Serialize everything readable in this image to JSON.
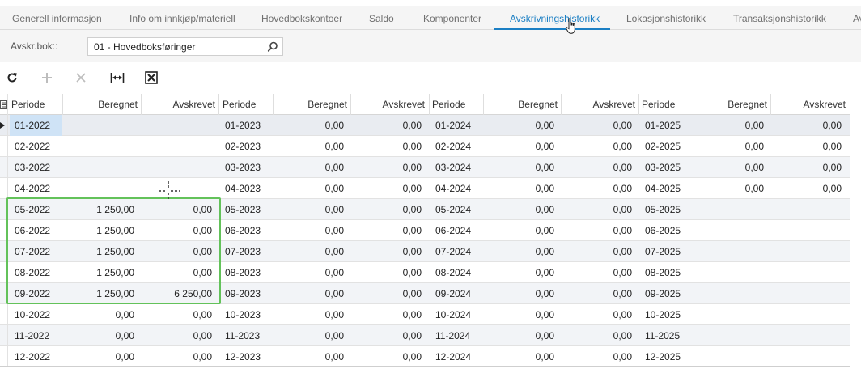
{
  "tabs": [
    {
      "label": "Generell informasjon",
      "active": false
    },
    {
      "label": "Info om innkjøp/materiell",
      "active": false
    },
    {
      "label": "Hovedbokskontoer",
      "active": false
    },
    {
      "label": "Saldo",
      "active": false
    },
    {
      "label": "Komponenter",
      "active": false
    },
    {
      "label": "Avskrivningshistorikk",
      "active": true
    },
    {
      "label": "Lokasjonshistorikk",
      "active": false
    },
    {
      "label": "Transaksjonshistorikk",
      "active": false
    },
    {
      "label": "Av",
      "active": false
    }
  ],
  "filter": {
    "label": "Avskr.bok::",
    "value": "01 - Hovedboksføringer"
  },
  "toolbar": {
    "icons": [
      "refresh-icon",
      "add-icon",
      "delete-icon",
      "fit-columns-icon",
      "export-excel-icon"
    ]
  },
  "grid": {
    "columns": [
      "Periode",
      "Beregnet",
      "Avskrevet",
      "Periode",
      "Beregnet",
      "Avskrevet",
      "Periode",
      "Beregnet",
      "Avskrevet",
      "Periode",
      "Beregnet",
      "Avskrevet"
    ],
    "rows": [
      [
        "01-2022",
        "",
        "",
        "01-2023",
        "0,00",
        "0,00",
        "01-2024",
        "0,00",
        "0,00",
        "01-2025",
        "0,00",
        "0,00"
      ],
      [
        "02-2022",
        "",
        "",
        "02-2023",
        "0,00",
        "0,00",
        "02-2024",
        "0,00",
        "0,00",
        "02-2025",
        "0,00",
        "0,00"
      ],
      [
        "03-2022",
        "",
        "",
        "03-2023",
        "0,00",
        "0,00",
        "03-2024",
        "0,00",
        "0,00",
        "03-2025",
        "0,00",
        "0,00"
      ],
      [
        "04-2022",
        "",
        "",
        "04-2023",
        "0,00",
        "0,00",
        "04-2024",
        "0,00",
        "0,00",
        "04-2025",
        "0,00",
        "0,00"
      ],
      [
        "05-2022",
        "1 250,00",
        "0,00",
        "05-2023",
        "0,00",
        "0,00",
        "05-2024",
        "0,00",
        "0,00",
        "05-2025",
        "",
        ""
      ],
      [
        "06-2022",
        "1 250,00",
        "0,00",
        "06-2023",
        "0,00",
        "0,00",
        "06-2024",
        "0,00",
        "0,00",
        "06-2025",
        "",
        ""
      ],
      [
        "07-2022",
        "1 250,00",
        "0,00",
        "07-2023",
        "0,00",
        "0,00",
        "07-2024",
        "0,00",
        "0,00",
        "07-2025",
        "",
        ""
      ],
      [
        "08-2022",
        "1 250,00",
        "0,00",
        "08-2023",
        "0,00",
        "0,00",
        "08-2024",
        "0,00",
        "0,00",
        "08-2025",
        "",
        ""
      ],
      [
        "09-2022",
        "1 250,00",
        "6 250,00",
        "09-2023",
        "0,00",
        "0,00",
        "09-2024",
        "0,00",
        "0,00",
        "09-2025",
        "",
        ""
      ],
      [
        "10-2022",
        "0,00",
        "0,00",
        "10-2023",
        "0,00",
        "0,00",
        "10-2024",
        "0,00",
        "0,00",
        "10-2025",
        "",
        ""
      ],
      [
        "11-2022",
        "0,00",
        "0,00",
        "11-2023",
        "0,00",
        "0,00",
        "11-2024",
        "0,00",
        "0,00",
        "11-2025",
        "",
        ""
      ],
      [
        "12-2022",
        "0,00",
        "0,00",
        "12-2023",
        "0,00",
        "0,00",
        "12-2024",
        "0,00",
        "0,00",
        "12-2025",
        "",
        ""
      ]
    ]
  },
  "colors": {
    "accent": "#1b7fc4",
    "highlight": "#63c25a",
    "selected_cell": "#cfe3f6"
  }
}
